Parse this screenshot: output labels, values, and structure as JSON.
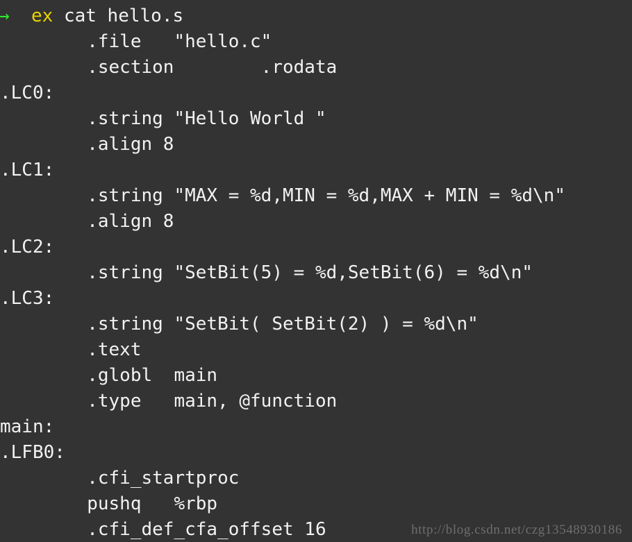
{
  "terminal": {
    "background_color": "#333333",
    "foreground_color": "#f2f2f2",
    "prompt_color": "#2ee62e",
    "command_color": "#e8d400",
    "watermark_color": "#6e6e6e",
    "tab_width_chars": 8
  },
  "prompt_line": {
    "prompt_symbol": "→",
    "context": "ex",
    "command": "cat hello.s",
    "spacer_before_context": "  ",
    "spacer_after_context": " "
  },
  "output_lines": [
    {
      "text": "        .file   \"hello.c\""
    },
    {
      "text": "        .section        .rodata"
    },
    {
      "text": ".LC0:"
    },
    {
      "text": "        .string \"Hello World \""
    },
    {
      "text": "        .align 8"
    },
    {
      "text": ".LC1:"
    },
    {
      "text": "        .string \"MAX = %d,MIN = %d,MAX + MIN = %d\\n\""
    },
    {
      "text": "        .align 8"
    },
    {
      "text": ".LC2:"
    },
    {
      "text": "        .string \"SetBit(5) = %d,SetBit(6) = %d\\n\""
    },
    {
      "text": ".LC3:"
    },
    {
      "text": "        .string \"SetBit( SetBit(2) ) = %d\\n\""
    },
    {
      "text": "        .text"
    },
    {
      "text": "        .globl  main"
    },
    {
      "text": "        .type   main, @function"
    },
    {
      "text": "main:"
    },
    {
      "text": ".LFB0:"
    },
    {
      "text": "        .cfi_startproc"
    },
    {
      "text": "        pushq   %rbp"
    },
    {
      "text": "        .cfi_def_cfa_offset 16"
    }
  ],
  "watermark": {
    "text": "http://blog.csdn.net/czg13548930186"
  }
}
